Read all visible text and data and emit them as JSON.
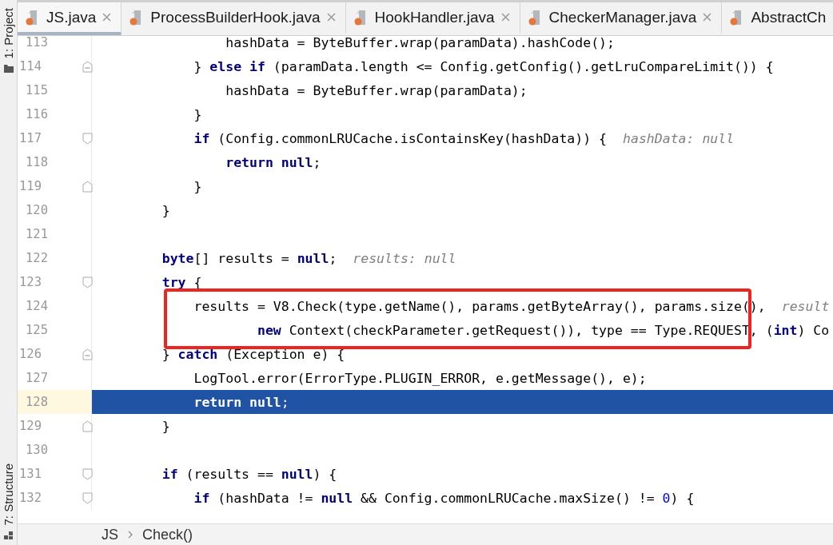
{
  "tool_windows": [
    {
      "label": "1: Project",
      "kind": "project"
    },
    {
      "label": "7: Structure",
      "kind": "structure"
    }
  ],
  "tabs": [
    {
      "label": "JS.java",
      "selected": true,
      "closable": true
    },
    {
      "label": "ProcessBuilderHook.java",
      "selected": false,
      "closable": true
    },
    {
      "label": "HookHandler.java",
      "selected": false,
      "closable": true
    },
    {
      "label": "CheckerManager.java",
      "selected": false,
      "closable": true
    },
    {
      "label": "AbstractCh",
      "selected": false,
      "closable": false
    }
  ],
  "lines": [
    {
      "number": "113",
      "selected": false,
      "boxed": false,
      "fold_start": false,
      "fold_end": false,
      "tokens": [
        {
          "kind": "plain",
          "text": "            hashData = ByteBuffer.wrap(paramData).hashCode();"
        }
      ]
    },
    {
      "number": "114",
      "selected": false,
      "boxed": false,
      "fold_start": true,
      "fold_end": true,
      "tokens": [
        {
          "kind": "plain",
          "text": "        } "
        },
        {
          "kind": "keyword",
          "text": "else if"
        },
        {
          "kind": "plain",
          "text": " (paramData.length <= Config.getConfig().getLruCompareLimit()) {"
        }
      ]
    },
    {
      "number": "115",
      "selected": false,
      "boxed": false,
      "fold_start": false,
      "fold_end": false,
      "tokens": [
        {
          "kind": "plain",
          "text": "            hashData = ByteBuffer.wrap(paramData);"
        }
      ]
    },
    {
      "number": "116",
      "selected": false,
      "boxed": false,
      "fold_start": false,
      "fold_end": false,
      "tokens": [
        {
          "kind": "plain",
          "text": "        }"
        }
      ]
    },
    {
      "number": "117",
      "selected": false,
      "boxed": false,
      "fold_start": true,
      "fold_end": false,
      "hint": "hashData: null",
      "tokens": [
        {
          "kind": "keyword",
          "text": "        if"
        },
        {
          "kind": "plain",
          "text": " (Config.commonLRUCache.isContainsKey(hashData)) {"
        }
      ]
    },
    {
      "number": "118",
      "selected": false,
      "boxed": false,
      "fold_start": false,
      "fold_end": false,
      "tokens": [
        {
          "kind": "keyword",
          "text": "            return null"
        },
        {
          "kind": "plain",
          "text": ";"
        }
      ]
    },
    {
      "number": "119",
      "selected": false,
      "boxed": false,
      "fold_start": false,
      "fold_end": true,
      "tokens": [
        {
          "kind": "plain",
          "text": "        }"
        }
      ]
    },
    {
      "number": "120",
      "selected": false,
      "boxed": false,
      "fold_start": false,
      "fold_end": false,
      "tokens": [
        {
          "kind": "plain",
          "text": "    }"
        }
      ]
    },
    {
      "number": "121",
      "selected": false,
      "boxed": false,
      "fold_start": false,
      "fold_end": false
    },
    {
      "number": "122",
      "selected": false,
      "boxed": false,
      "fold_start": false,
      "fold_end": false,
      "hint": "results: null",
      "tokens": [
        {
          "kind": "keyword",
          "text": "    byte"
        },
        {
          "kind": "plain",
          "text": "[] results = "
        },
        {
          "kind": "keyword",
          "text": "null"
        },
        {
          "kind": "plain",
          "text": ";"
        }
      ]
    },
    {
      "number": "123",
      "selected": false,
      "boxed": false,
      "fold_start": true,
      "fold_end": false,
      "tokens": [
        {
          "kind": "keyword",
          "text": "    try"
        },
        {
          "kind": "plain",
          "text": " {"
        }
      ]
    },
    {
      "number": "124",
      "selected": false,
      "boxed": true,
      "fold_start": false,
      "fold_end": false,
      "hint": "result",
      "tokens": [
        {
          "kind": "plain",
          "text": "        results = V8.Check(type.getName(), params.getByteArray(), params.size(),"
        }
      ]
    },
    {
      "number": "125",
      "selected": false,
      "boxed": true,
      "fold_start": false,
      "fold_end": false,
      "tokens": [
        {
          "kind": "keyword",
          "text": "                new"
        },
        {
          "kind": "plain",
          "text": " Context(checkParameter.getRequest()), type == Type.REQUEST, ("
        },
        {
          "kind": "keyword",
          "text": "int"
        },
        {
          "kind": "plain",
          "text": ") Co"
        }
      ]
    },
    {
      "number": "126",
      "selected": false,
      "boxed": false,
      "fold_start": true,
      "fold_end": true,
      "tokens": [
        {
          "kind": "plain",
          "text": "    } "
        },
        {
          "kind": "keyword",
          "text": "catch"
        },
        {
          "kind": "plain",
          "text": " (Exception e) {"
        }
      ]
    },
    {
      "number": "127",
      "selected": false,
      "boxed": false,
      "fold_start": false,
      "fold_end": false,
      "tokens": [
        {
          "kind": "plain",
          "text": "        LogTool.error(ErrorType.PLUGIN_ERROR, e.getMessage(), e);"
        }
      ]
    },
    {
      "number": "128",
      "selected": true,
      "boxed": false,
      "fold_start": false,
      "fold_end": false,
      "tokens": [
        {
          "kind": "keyword",
          "text": "        return null"
        },
        {
          "kind": "plain",
          "text": ";"
        }
      ]
    },
    {
      "number": "129",
      "selected": false,
      "boxed": false,
      "fold_start": false,
      "fold_end": true,
      "tokens": [
        {
          "kind": "plain",
          "text": "    }"
        }
      ]
    },
    {
      "number": "130",
      "selected": false,
      "boxed": false,
      "fold_start": false,
      "fold_end": false
    },
    {
      "number": "131",
      "selected": false,
      "boxed": false,
      "fold_start": true,
      "fold_end": false,
      "tokens": [
        {
          "kind": "keyword",
          "text": "    if"
        },
        {
          "kind": "plain",
          "text": " (results == "
        },
        {
          "kind": "keyword",
          "text": "null"
        },
        {
          "kind": "plain",
          "text": ") {"
        }
      ]
    },
    {
      "number": "132",
      "selected": false,
      "boxed": false,
      "fold_start": true,
      "fold_end": false,
      "tokens": [
        {
          "kind": "keyword",
          "text": "        if"
        },
        {
          "kind": "plain",
          "text": " (hashData != "
        },
        {
          "kind": "keyword",
          "text": "null"
        },
        {
          "kind": "plain",
          "text": " && Config.commonLRUCache.maxSize() != "
        },
        {
          "kind": "number",
          "text": "0"
        },
        {
          "kind": "plain",
          "text": ") {"
        }
      ]
    }
  ],
  "breadcrumbs": [
    "JS",
    "Check()"
  ]
}
